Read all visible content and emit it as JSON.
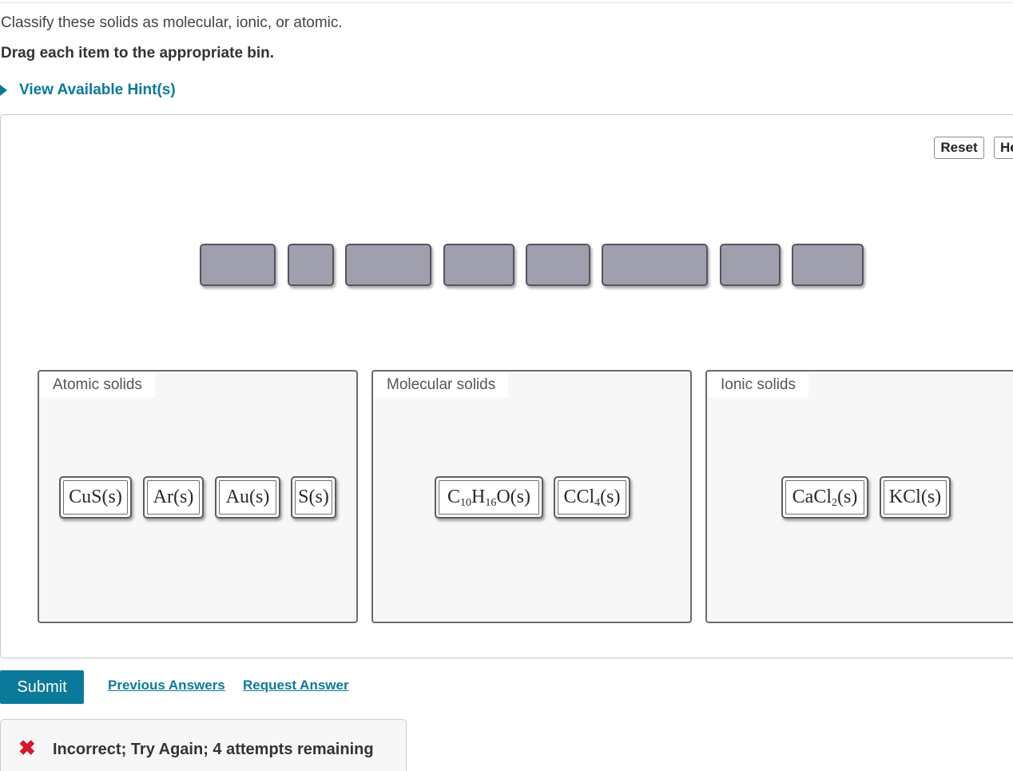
{
  "question": {
    "prompt": "Classify these solids as molecular, ionic, or atomic.",
    "instruction": "Drag each item to the appropriate bin."
  },
  "hints": {
    "toggle_label": "View Available Hint(s)",
    "caret_icon": "caret-right-icon"
  },
  "toolbar": {
    "reset_label": "Reset",
    "help_label": "He"
  },
  "item_pool": {
    "empty_slot_count": 8
  },
  "bins": [
    {
      "label": "Atomic solids",
      "items": [
        {
          "text": "CuS(s)"
        },
        {
          "text": "Ar(s)"
        },
        {
          "text": "Au(s)"
        },
        {
          "text": "S(s)"
        }
      ]
    },
    {
      "label": "Molecular solids",
      "items": [
        {
          "base1": "C",
          "sub1": "10",
          "base2": "H",
          "sub2": "16",
          "base3": "O(s)"
        },
        {
          "base1": "CCl",
          "sub1": "4",
          "base2": "(s)"
        }
      ]
    },
    {
      "label": "Ionic solids",
      "items": [
        {
          "base1": "CaCl",
          "sub1": "2",
          "base2": "(s)"
        },
        {
          "text": "KCl(s)"
        }
      ]
    }
  ],
  "actions": {
    "submit_label": "Submit",
    "previous_answers_label": "Previous Answers",
    "request_answer_label": "Request Answer"
  },
  "feedback": {
    "icon": "x-mark-icon",
    "color": "#d6182d",
    "message": "Incorrect; Try Again; 4 attempts remaining"
  },
  "colors": {
    "accent": "#0b7a9a",
    "slot_fill": "#a09fae",
    "error": "#d6182d"
  }
}
